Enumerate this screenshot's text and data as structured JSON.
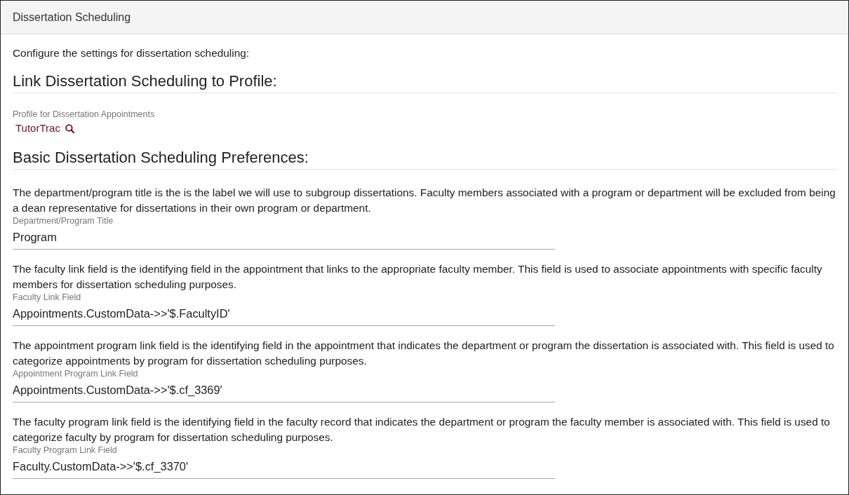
{
  "panel": {
    "title": "Dissertation Scheduling"
  },
  "intro": "Configure the settings for dissertation scheduling:",
  "sections": [
    {
      "heading": "Link Dissertation Scheduling to Profile:",
      "fields": [
        {
          "kind": "lookup",
          "label": "Profile for Dissertation Appointments",
          "value": "TutorTrac"
        }
      ]
    },
    {
      "heading": "Basic Dissertation Scheduling Preferences:",
      "fields": [
        {
          "kind": "text",
          "description": "The department/program title is the is the label we will use to subgroup dissertations. Faculty members associated with a program or department will be excluded from being a dean representative for dissertations in their own program or department.",
          "label": "Department/Program Title",
          "value": "Program"
        },
        {
          "kind": "text",
          "description": "The faculty link field is the identifying field in the appointment that links to the appropriate faculty member. This field is used to associate appointments with specific faculty members for dissertation scheduling purposes.",
          "label": "Faculty Link Field",
          "value": "Appointments.CustomData->>'$.FacultyID'"
        },
        {
          "kind": "text",
          "description": "The appointment program link field is the identifying field in the appointment that indicates the department or program the dissertation is associated with. This field is used to categorize appointments by program for dissertation scheduling purposes.",
          "label": "Appointment Program Link Field",
          "value": "Appointments.CustomData->>'$.cf_3369'"
        },
        {
          "kind": "text",
          "description": "The faculty program link field is the identifying field in the faculty record that indicates the department or program the faculty member is associated with. This field is used to categorize faculty by program for dissertation scheduling purposes.",
          "label": "Faculty Program Link Field",
          "value": "Faculty.CustomData->>'$.cf_3370'"
        }
      ]
    }
  ]
}
